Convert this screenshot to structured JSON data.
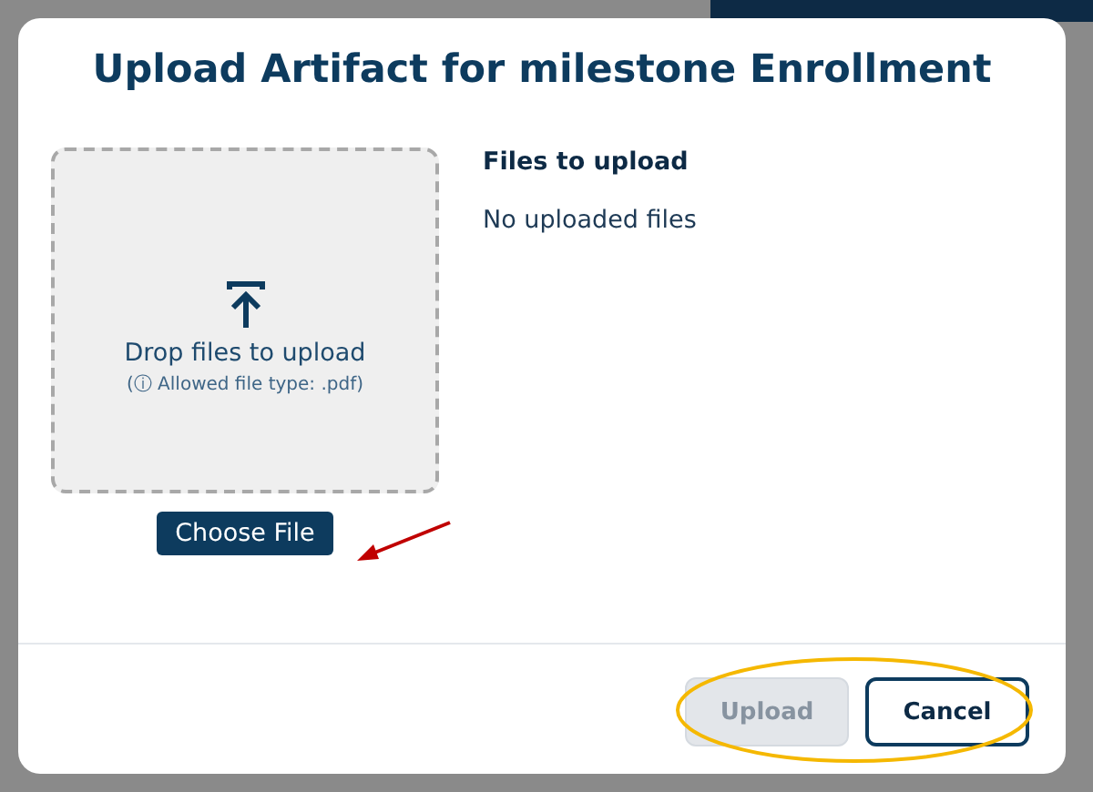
{
  "dialog": {
    "title": "Upload Artifact for milestone Enrollment",
    "drop_zone": {
      "label": "Drop files to upload",
      "hint": "(ⓘ Allowed file type: .pdf)"
    },
    "choose_button": {
      "label": "Choose File"
    },
    "files": {
      "heading": "Files to upload",
      "empty_text": "No uploaded files"
    },
    "buttons": [
      {
        "label": "Upload",
        "kind": "primary",
        "disabled": true
      },
      {
        "label": "Cancel",
        "kind": "secondary",
        "disabled": false
      }
    ]
  }
}
